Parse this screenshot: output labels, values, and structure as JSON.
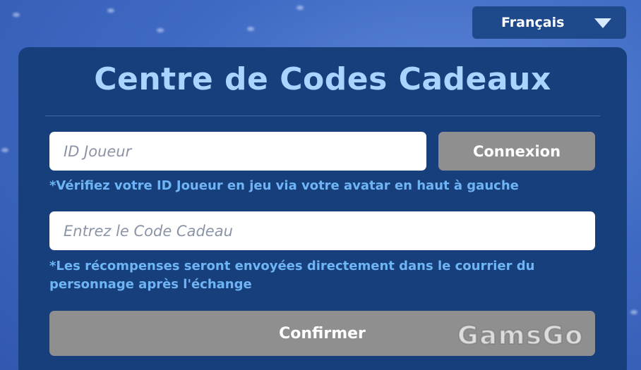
{
  "language_selector": {
    "selected": "Français"
  },
  "panel": {
    "title": "Centre de Codes Cadeaux"
  },
  "player_id_field": {
    "placeholder": "ID Joueur",
    "value": ""
  },
  "login_button": {
    "label": "Connexion"
  },
  "player_id_hint": "*Vérifiez votre ID Joueur en jeu via votre avatar en haut à gauche",
  "gift_code_field": {
    "placeholder": "Entrez le Code Cadeau",
    "value": ""
  },
  "gift_code_hint": "*Les récompenses seront envoyées directement dans le courrier du personnage après l'échange",
  "confirm_button": {
    "label": "Confirmer"
  },
  "watermark": "GamsGo",
  "colors": {
    "panel_background": "#173f7c",
    "title_color": "#a9d4ff",
    "hint_color": "#6fb5f5",
    "button_disabled": "#8f8f8f",
    "page_background": "#3f6ac4"
  },
  "icons": {
    "language_dropdown": "triangle-down-icon"
  }
}
